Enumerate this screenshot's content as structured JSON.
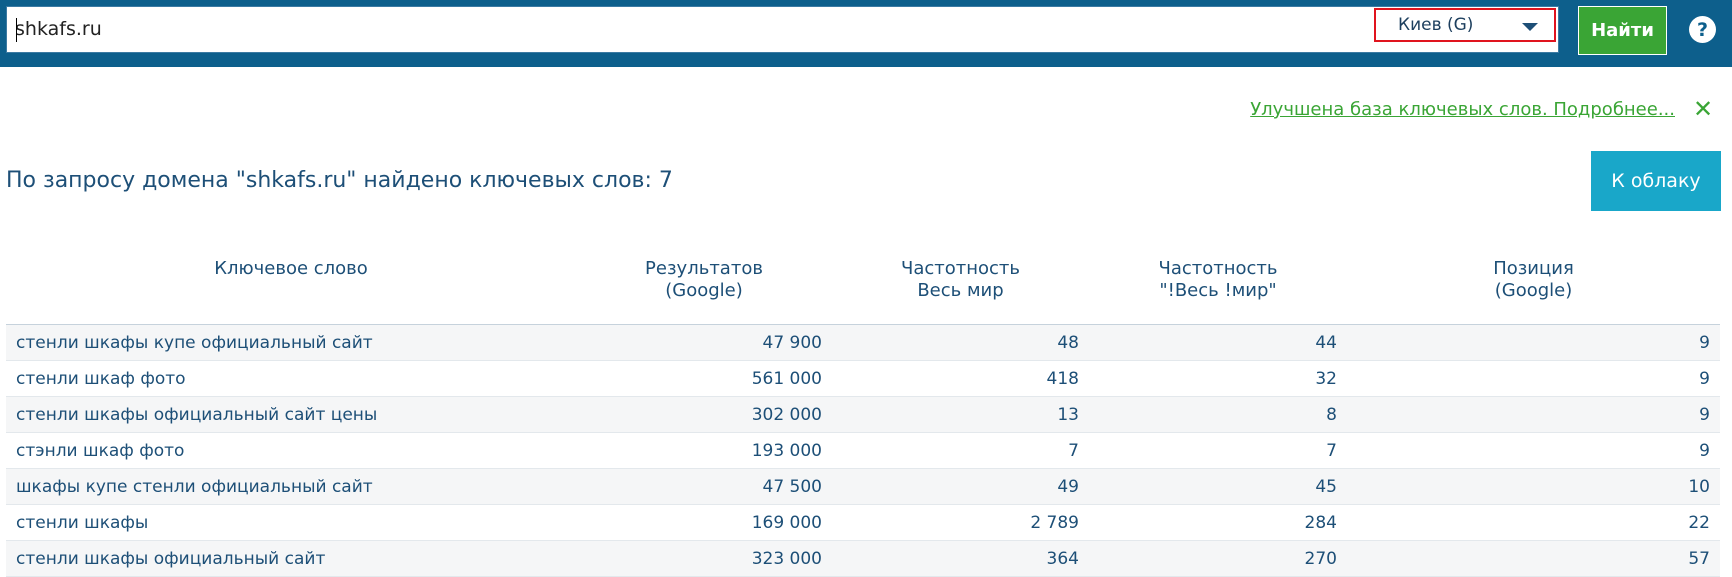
{
  "search": {
    "query": "shkafs.ru",
    "region": "Киев (G)",
    "find_label": "Найти",
    "help_label": "?"
  },
  "notice": {
    "text": "Улучшена база ключевых слов. Подробнее...",
    "close_glyph": "✕"
  },
  "result_title": "По запросу домена \"shkafs.ru\" найдено ключевых слов: 7",
  "cloud_button": "К облаку",
  "table": {
    "headers": [
      {
        "line1": "Ключевое слово",
        "line2": ""
      },
      {
        "line1": "Результатов",
        "line2": "(Google)"
      },
      {
        "line1": "Частотность",
        "line2": "Весь мир"
      },
      {
        "line1": "Частотность",
        "line2": "\"!Весь !мир\""
      },
      {
        "line1": "Позиция",
        "line2": "(Google)"
      }
    ],
    "rows": [
      [
        "стенли шкафы купе официальный сайт",
        "47 900",
        "48",
        "44",
        "9"
      ],
      [
        "стенли шкаф фото",
        "561 000",
        "418",
        "32",
        "9"
      ],
      [
        "стенли шкафы официальный сайт цены",
        "302 000",
        "13",
        "8",
        "9"
      ],
      [
        "стэнли шкаф фото",
        "193 000",
        "7",
        "7",
        "9"
      ],
      [
        "шкафы купе стенли официальный сайт",
        "47 500",
        "49",
        "45",
        "10"
      ],
      [
        "стенли шкафы",
        "169 000",
        "2 789",
        "284",
        "22"
      ],
      [
        "стенли шкафы официальный сайт",
        "323 000",
        "364",
        "270",
        "57"
      ]
    ]
  },
  "colors": {
    "topbar": "#0d5f8c",
    "accent_green": "#3aa535",
    "accent_cyan": "#19a7c9",
    "text": "#1d4f77",
    "highlight": "#e0141e"
  }
}
